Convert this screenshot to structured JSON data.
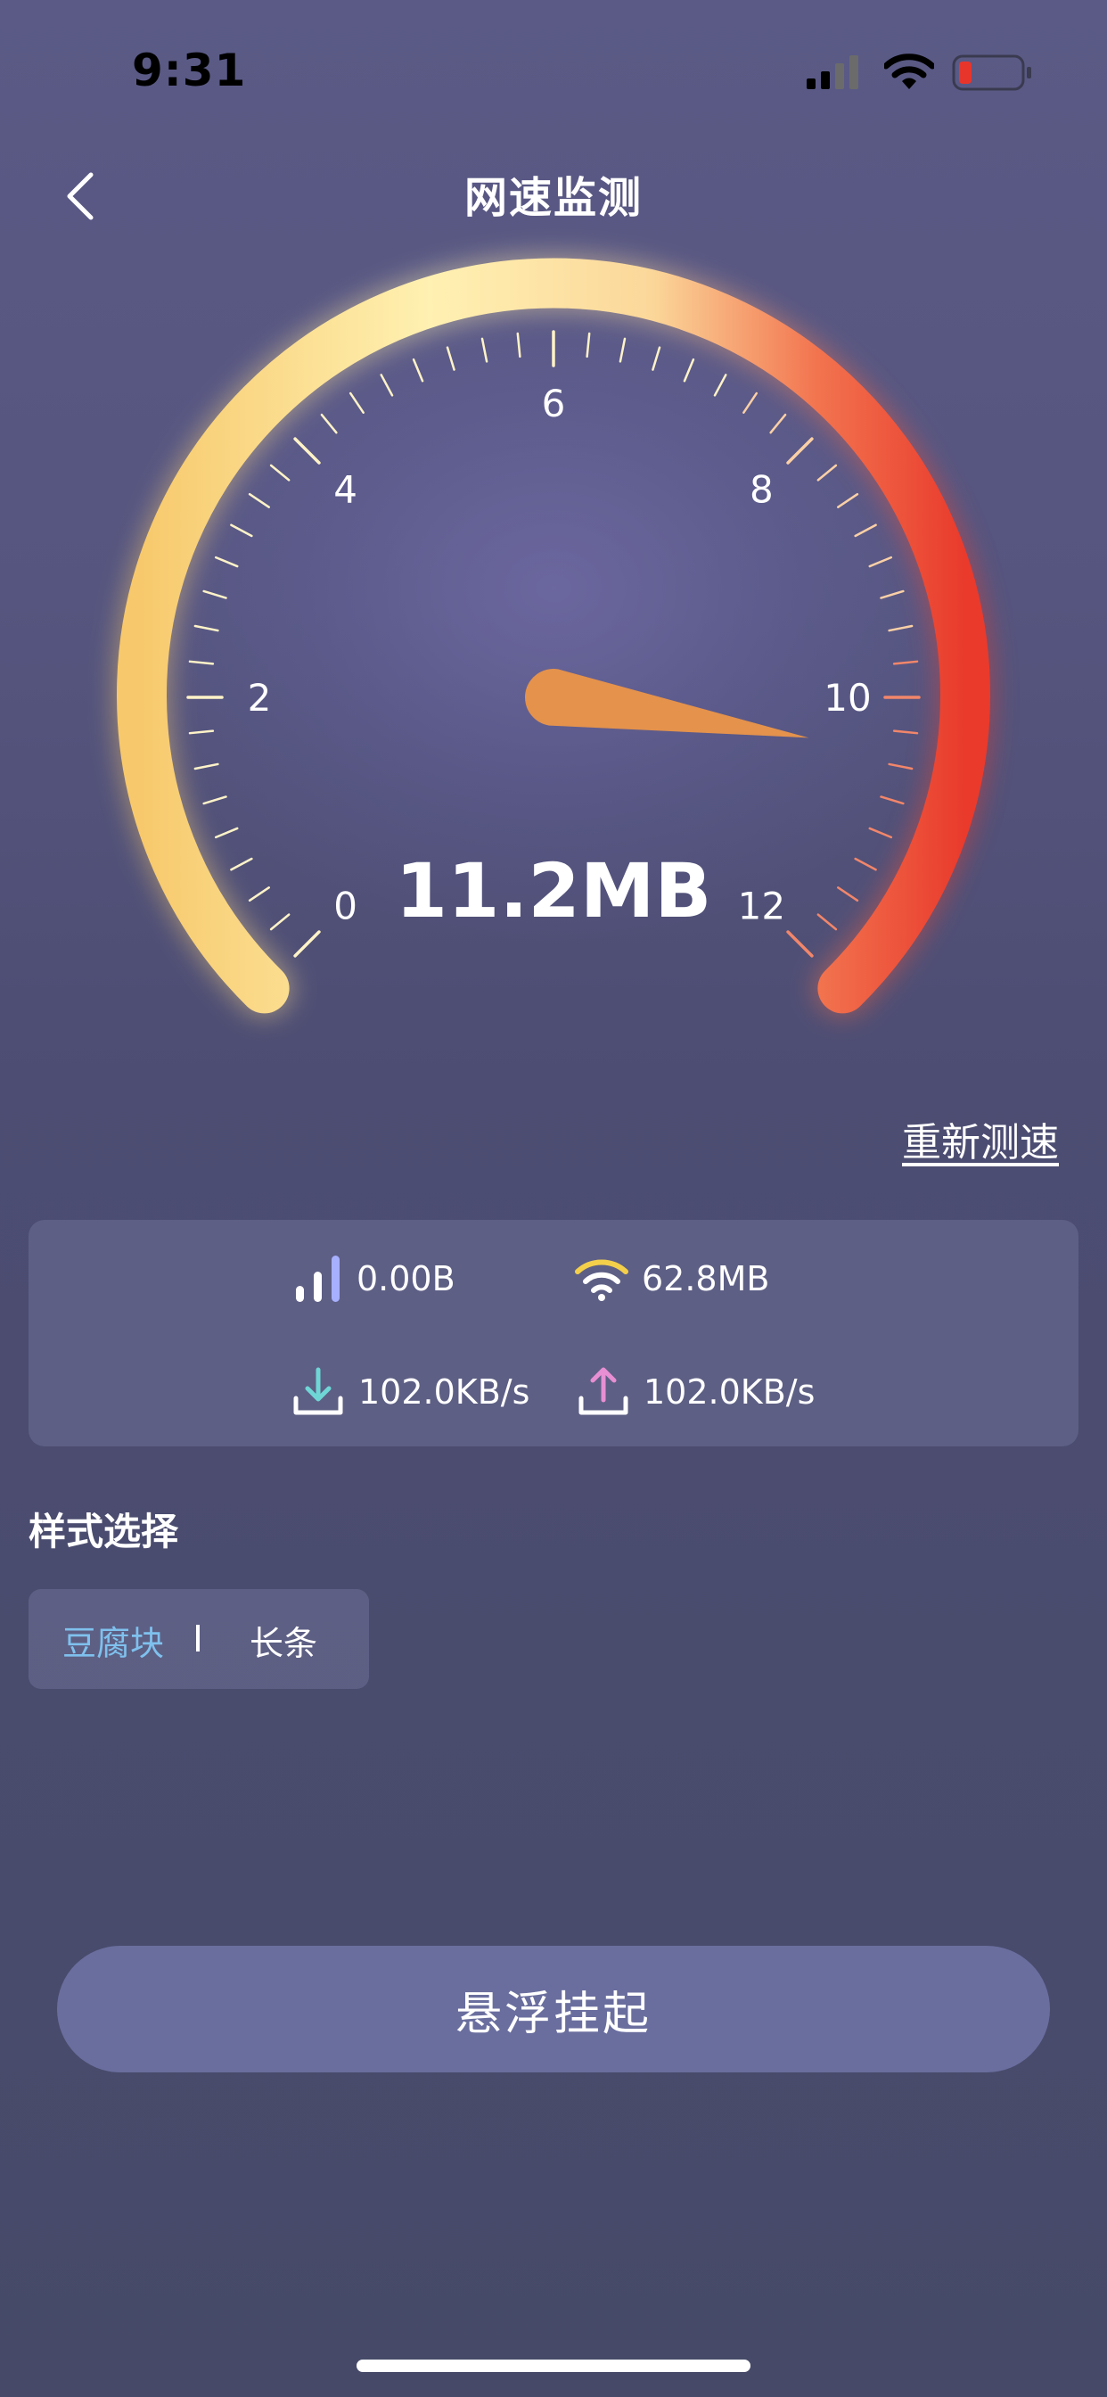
{
  "status_bar": {
    "time": "9:31",
    "signal_icon": "cellular-signal-icon",
    "wifi_icon": "wifi-icon",
    "battery_icon": "battery-low-icon"
  },
  "header": {
    "back_icon": "chevron-left-icon",
    "title": "网速监测"
  },
  "gauge": {
    "tick_labels": [
      "0",
      "2",
      "4",
      "6",
      "8",
      "10",
      "12"
    ],
    "min": 0,
    "max": 12,
    "needle_value": 10.4,
    "reading": "11.2MB",
    "gradient_colors": [
      "#f7c86c",
      "#fff2b6",
      "#f2744f",
      "#e93a2c"
    ]
  },
  "retest_label": "重新测速",
  "stats": {
    "mobile_data": {
      "icon": "cellular-bars-icon",
      "value": "0.00B"
    },
    "wifi_data": {
      "icon": "wifi-icon",
      "value": "62.8MB"
    },
    "download": {
      "icon": "download-icon",
      "value": "102.0KB/s"
    },
    "upload": {
      "icon": "upload-icon",
      "value": "102.0KB/s"
    }
  },
  "style_section": {
    "heading": "样式选择",
    "options": [
      "豆腐块",
      "长条"
    ],
    "selected": "豆腐块",
    "selected_color": "#7fc1ee"
  },
  "float_button_label": "悬浮挂起"
}
